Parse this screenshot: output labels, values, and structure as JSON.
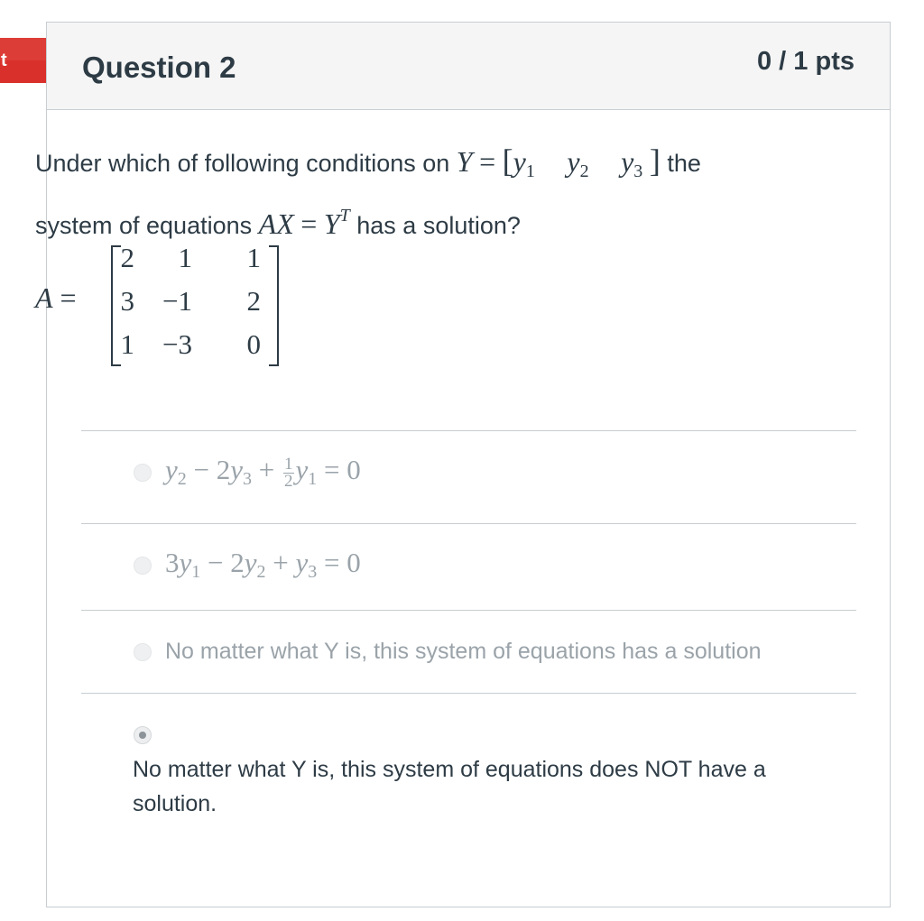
{
  "flag": {
    "label": "t",
    "color": "#d9302b"
  },
  "question": {
    "title": "Question 2",
    "points": "0 / 1 pts",
    "text_before": "Under which of following conditions on",
    "text_the": "the",
    "text_system": "system of equations",
    "text_after": "has a solution?",
    "Y_symbol": "Y",
    "y_entries": [
      "y",
      "y",
      "y"
    ],
    "y_subs": [
      "1",
      "2",
      "3"
    ],
    "AX": "AX",
    "eq": "=",
    "YT_base": "Y",
    "YT_sup": "T"
  },
  "matrix": {
    "name": "A",
    "eq": "=",
    "rows": [
      [
        "2",
        "1",
        "1"
      ],
      [
        "3",
        "−1",
        "2"
      ],
      [
        "1",
        "−3",
        "0"
      ]
    ]
  },
  "answers": [
    {
      "id": "a1",
      "parts": {
        "t1": "y",
        "s1": "2",
        "t2": " − 2",
        "t3": "y",
        "s3": "3",
        "t4": " + ",
        "num": "1",
        "den": "2",
        "t5": "y",
        "s5": "1",
        "t6": " = 0"
      },
      "selected": false
    },
    {
      "id": "a2",
      "parts": {
        "t1": "3",
        "t2": "y",
        "s2": "1",
        "t3": " − 2",
        "t4": "y",
        "s4": "2",
        "t5": " + ",
        "t6": "y",
        "s6": "3",
        "t7": " = 0"
      },
      "selected": false
    },
    {
      "id": "a3",
      "text": "No matter what Y is, this system of equations has a solution",
      "selected": false
    },
    {
      "id": "a4",
      "text": "No matter what Y is, this system of equations does NOT have a solution.",
      "selected": true
    }
  ]
}
